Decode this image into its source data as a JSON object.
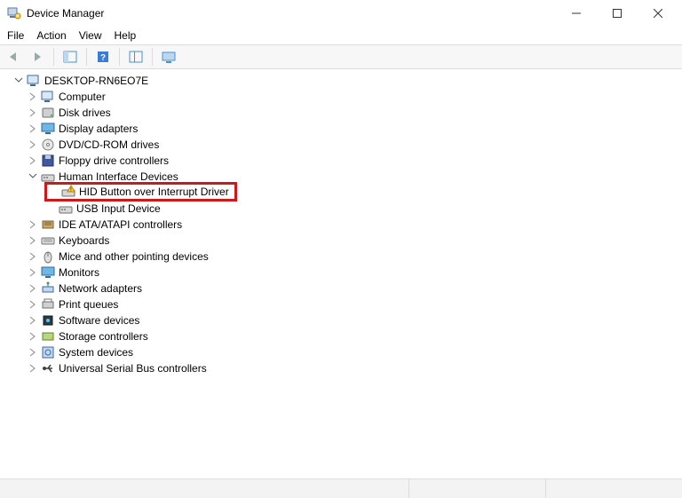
{
  "window": {
    "title": "Device Manager"
  },
  "menu": {
    "file": "File",
    "action": "Action",
    "view": "View",
    "help": "Help"
  },
  "tree": {
    "root": {
      "label": "DESKTOP-RN6EO7E",
      "expanded": true
    },
    "items": [
      {
        "label": "Computer",
        "expanded": false,
        "icon": "computer"
      },
      {
        "label": "Disk drives",
        "expanded": false,
        "icon": "disk"
      },
      {
        "label": "Display adapters",
        "expanded": false,
        "icon": "display"
      },
      {
        "label": "DVD/CD-ROM drives",
        "expanded": false,
        "icon": "disc"
      },
      {
        "label": "Floppy drive controllers",
        "expanded": false,
        "icon": "floppy"
      },
      {
        "label": "Human Interface Devices",
        "expanded": true,
        "icon": "hid",
        "children": [
          {
            "label": "HID Button over Interrupt Driver",
            "icon": "hid-warn",
            "highlighted": true
          },
          {
            "label": "USB Input Device",
            "icon": "hid"
          }
        ]
      },
      {
        "label": "IDE ATA/ATAPI controllers",
        "expanded": false,
        "icon": "ide"
      },
      {
        "label": "Keyboards",
        "expanded": false,
        "icon": "keyboard"
      },
      {
        "label": "Mice and other pointing devices",
        "expanded": false,
        "icon": "mouse"
      },
      {
        "label": "Monitors",
        "expanded": false,
        "icon": "monitor"
      },
      {
        "label": "Network adapters",
        "expanded": false,
        "icon": "network"
      },
      {
        "label": "Print queues",
        "expanded": false,
        "icon": "printer"
      },
      {
        "label": "Software devices",
        "expanded": false,
        "icon": "software"
      },
      {
        "label": "Storage controllers",
        "expanded": false,
        "icon": "storage"
      },
      {
        "label": "System devices",
        "expanded": false,
        "icon": "system"
      },
      {
        "label": "Universal Serial Bus controllers",
        "expanded": false,
        "icon": "usb"
      }
    ]
  }
}
